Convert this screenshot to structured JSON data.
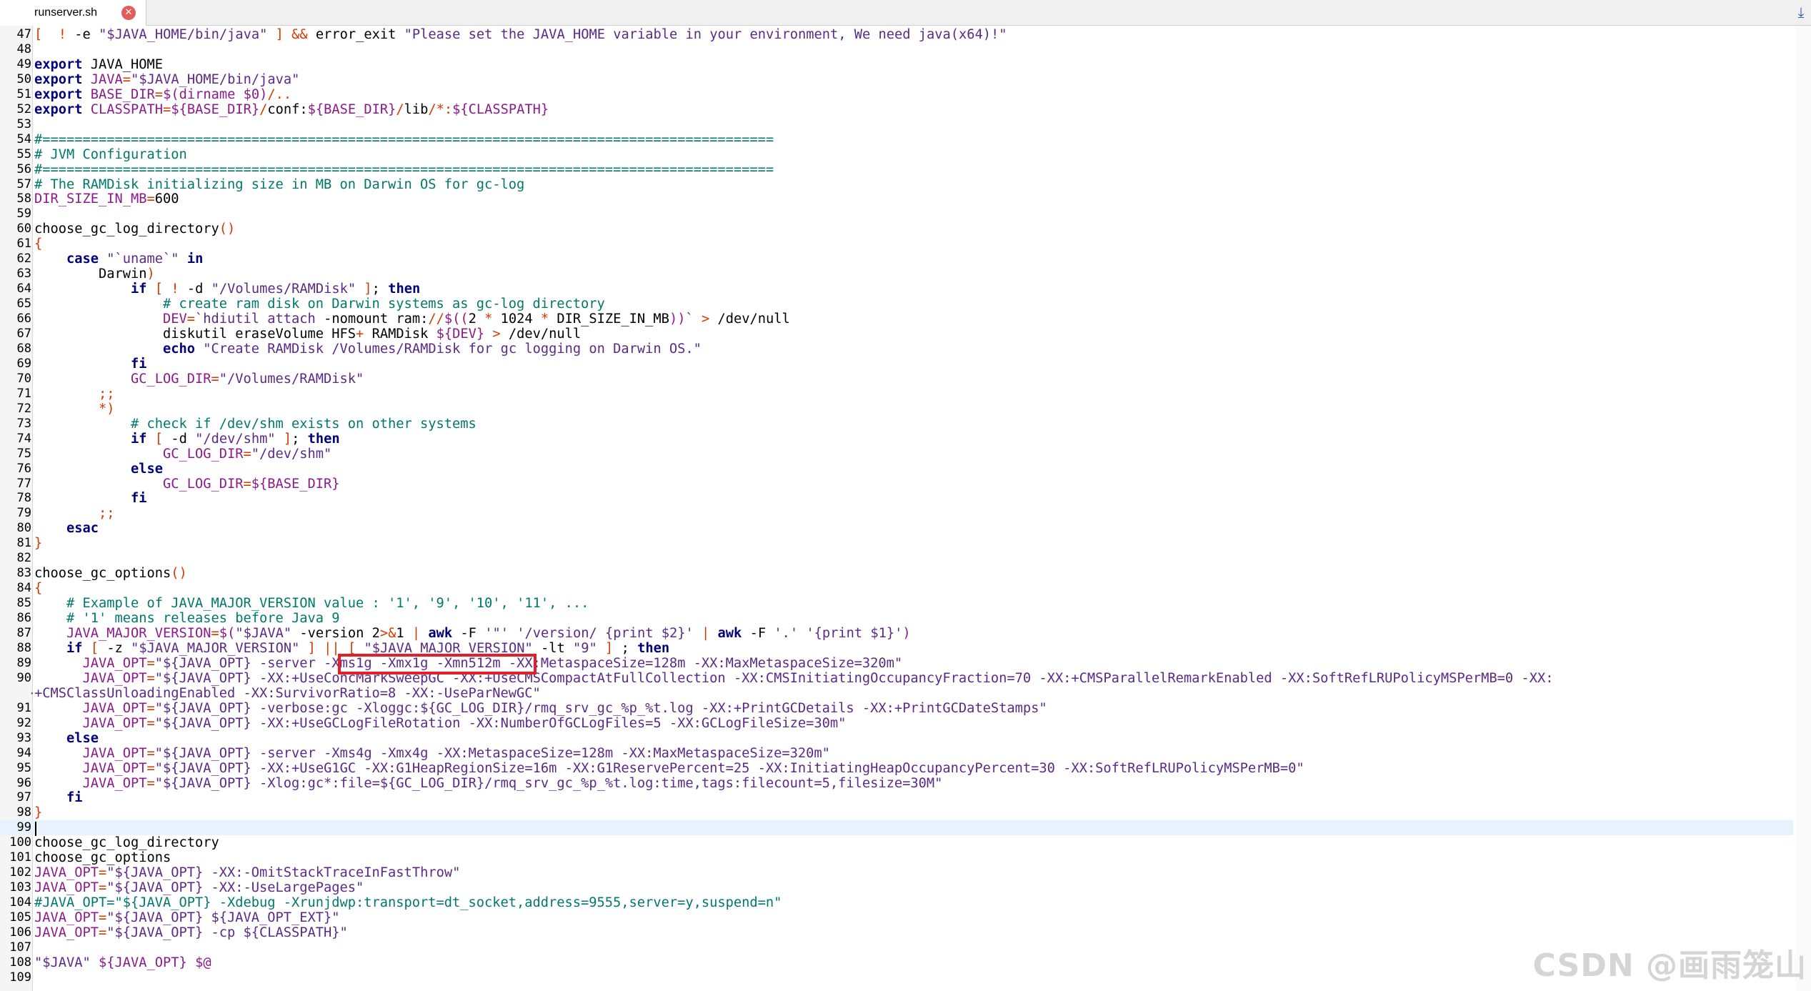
{
  "tab": {
    "title": "runserver.sh",
    "close_icon": "close-icon",
    "scroll_icon": "down-arrow-icon"
  },
  "watermark": "CSDN @画雨笼山",
  "colors": {
    "keyword": "#00007a",
    "string": "#5b2a86",
    "variable": "#8b1a8b",
    "comment": "#00796b",
    "operator": "#d63a00",
    "highlight_box": "#e3202a"
  },
  "current_line": 99,
  "lines": [
    {
      "n": "47",
      "t": [
        [
          "op",
          "["
        ],
        [
          "",
          "  "
        ],
        [
          "op",
          "!"
        ],
        [
          "",
          " -e "
        ],
        [
          "str",
          "\"$JAVA_HOME/bin/java\""
        ],
        [
          "",
          " "
        ],
        [
          "op",
          "]"
        ],
        [
          "",
          " "
        ],
        [
          "op",
          "&&"
        ],
        [
          "",
          " error_exit "
        ],
        [
          "str",
          "\"Please set the JAVA_HOME variable in your environment, We need java(x64)!\""
        ]
      ]
    },
    {
      "n": "48",
      "t": []
    },
    {
      "n": "49",
      "t": [
        [
          "kw",
          "export"
        ],
        [
          "",
          " JAVA_HOME"
        ]
      ]
    },
    {
      "n": "50",
      "t": [
        [
          "kw",
          "export"
        ],
        [
          "",
          " "
        ],
        [
          "var",
          "JAVA"
        ],
        [
          "op",
          "="
        ],
        [
          "str",
          "\"$JAVA_HOME/bin/java\""
        ]
      ]
    },
    {
      "n": "51",
      "t": [
        [
          "kw",
          "export"
        ],
        [
          "",
          " "
        ],
        [
          "var",
          "BASE_DIR"
        ],
        [
          "op",
          "="
        ],
        [
          "var",
          "$(dirname $0)"
        ],
        [
          "op",
          "/.."
        ]
      ]
    },
    {
      "n": "52",
      "t": [
        [
          "kw",
          "export"
        ],
        [
          "",
          " "
        ],
        [
          "var",
          "CLASSPATH"
        ],
        [
          "op",
          "="
        ],
        [
          ".:"
        ],
        [
          "var",
          "${BASE_DIR}"
        ],
        [
          "op",
          "/"
        ],
        [
          "",
          "conf:"
        ],
        [
          "var",
          "${BASE_DIR}"
        ],
        [
          "op",
          "/"
        ],
        [
          "",
          "lib"
        ],
        [
          "op",
          "/*:"
        ],
        [
          "var",
          "${CLASSPATH}"
        ]
      ]
    },
    {
      "n": "53",
      "t": []
    },
    {
      "n": "54",
      "t": [
        [
          "com",
          "#==========================================================================================="
        ]
      ]
    },
    {
      "n": "55",
      "t": [
        [
          "com",
          "# JVM Configuration"
        ]
      ]
    },
    {
      "n": "56",
      "t": [
        [
          "com",
          "#==========================================================================================="
        ]
      ]
    },
    {
      "n": "57",
      "t": [
        [
          "com",
          "# The RAMDisk initializing size in MB on Darwin OS for gc-log"
        ]
      ]
    },
    {
      "n": "58",
      "t": [
        [
          "var",
          "DIR_SIZE_IN_MB"
        ],
        [
          "op",
          "="
        ],
        [
          "",
          "600"
        ]
      ]
    },
    {
      "n": "59",
      "t": []
    },
    {
      "n": "60",
      "t": [
        [
          "",
          "choose_gc_log_directory"
        ],
        [
          "op",
          "()"
        ]
      ]
    },
    {
      "n": "61",
      "t": [
        [
          "op",
          "{"
        ]
      ]
    },
    {
      "n": "62",
      "t": [
        [
          "",
          "    "
        ],
        [
          "kw",
          "case"
        ],
        [
          "",
          " "
        ],
        [
          "str",
          "\"`uname`\""
        ],
        [
          "",
          " "
        ],
        [
          "kw",
          "in"
        ]
      ]
    },
    {
      "n": "63",
      "t": [
        [
          "",
          "        Darwin"
        ],
        [
          "op",
          ")"
        ]
      ]
    },
    {
      "n": "64",
      "t": [
        [
          "",
          "            "
        ],
        [
          "kw",
          "if"
        ],
        [
          "",
          " "
        ],
        [
          "op",
          "["
        ],
        [
          "",
          " "
        ],
        [
          "op",
          "!"
        ],
        [
          "",
          " -d "
        ],
        [
          "str",
          "\"/Volumes/RAMDisk\""
        ],
        [
          "",
          " "
        ],
        [
          "op",
          "]"
        ],
        [
          "",
          ";"
        ],
        [
          "",
          " "
        ],
        [
          "kw",
          "then"
        ]
      ]
    },
    {
      "n": "65",
      "t": [
        [
          "",
          "                "
        ],
        [
          "com",
          "# create ram disk on Darwin systems as gc-log directory"
        ]
      ]
    },
    {
      "n": "66",
      "t": [
        [
          "",
          "                "
        ],
        [
          "var",
          "DEV"
        ],
        [
          "op",
          "="
        ],
        [
          "str",
          "`hdiutil attach "
        ],
        [
          "",
          "-nomount ram:"
        ],
        [
          "op",
          "//"
        ],
        [
          "var",
          "$(("
        ],
        [
          "",
          "2 "
        ],
        [
          "op",
          "*"
        ],
        [
          "",
          " 1024 "
        ],
        [
          "op",
          "*"
        ],
        [
          "",
          " DIR_SIZE_IN_MB"
        ],
        [
          "var",
          "))"
        ],
        [
          "str",
          "`"
        ],
        [
          "",
          " "
        ],
        [
          "op",
          ">"
        ],
        [
          "",
          " /dev/null"
        ]
      ]
    },
    {
      "n": "67",
      "t": [
        [
          "",
          "                diskutil eraseVolume HFS"
        ],
        [
          "op",
          "+"
        ],
        [
          "",
          " RAMDisk "
        ],
        [
          "var",
          "${DEV}"
        ],
        [
          "",
          " "
        ],
        [
          "op",
          ">"
        ],
        [
          "",
          " /dev/null"
        ]
      ]
    },
    {
      "n": "68",
      "t": [
        [
          "",
          "                "
        ],
        [
          "kw",
          "echo"
        ],
        [
          "",
          " "
        ],
        [
          "str",
          "\"Create RAMDisk /Volumes/RAMDisk for gc logging on Darwin OS.\""
        ]
      ]
    },
    {
      "n": "69",
      "t": [
        [
          "",
          "            "
        ],
        [
          "kw",
          "fi"
        ]
      ]
    },
    {
      "n": "70",
      "t": [
        [
          "",
          "            "
        ],
        [
          "var",
          "GC_LOG_DIR"
        ],
        [
          "op",
          "="
        ],
        [
          "str",
          "\"/Volumes/RAMDisk\""
        ]
      ]
    },
    {
      "n": "71",
      "t": [
        [
          "",
          "        "
        ],
        [
          "op",
          ";;"
        ]
      ]
    },
    {
      "n": "72",
      "t": [
        [
          "",
          "        "
        ],
        [
          "op",
          "*)"
        ]
      ]
    },
    {
      "n": "73",
      "t": [
        [
          "",
          "            "
        ],
        [
          "com",
          "# check if /dev/shm exists on other systems"
        ]
      ]
    },
    {
      "n": "74",
      "t": [
        [
          "",
          "            "
        ],
        [
          "kw",
          "if"
        ],
        [
          "",
          " "
        ],
        [
          "op",
          "["
        ],
        [
          "",
          " -d "
        ],
        [
          "str",
          "\"/dev/shm\""
        ],
        [
          "",
          " "
        ],
        [
          "op",
          "]"
        ],
        [
          "",
          ";"
        ],
        [
          "",
          " "
        ],
        [
          "kw",
          "then"
        ]
      ]
    },
    {
      "n": "75",
      "t": [
        [
          "",
          "                "
        ],
        [
          "var",
          "GC_LOG_DIR"
        ],
        [
          "op",
          "="
        ],
        [
          "str",
          "\"/dev/shm\""
        ]
      ]
    },
    {
      "n": "76",
      "t": [
        [
          "",
          "            "
        ],
        [
          "kw",
          "else"
        ]
      ]
    },
    {
      "n": "77",
      "t": [
        [
          "",
          "                "
        ],
        [
          "var",
          "GC_LOG_DIR"
        ],
        [
          "op",
          "="
        ],
        [
          "var",
          "${BASE_DIR}"
        ]
      ]
    },
    {
      "n": "78",
      "t": [
        [
          "",
          "            "
        ],
        [
          "kw",
          "fi"
        ]
      ]
    },
    {
      "n": "79",
      "t": [
        [
          "",
          "        "
        ],
        [
          "op",
          ";;"
        ]
      ]
    },
    {
      "n": "80",
      "t": [
        [
          "",
          "    "
        ],
        [
          "kw",
          "esac"
        ]
      ]
    },
    {
      "n": "81",
      "t": [
        [
          "op",
          "}"
        ]
      ]
    },
    {
      "n": "82",
      "t": []
    },
    {
      "n": "83",
      "t": [
        [
          "",
          "choose_gc_options"
        ],
        [
          "op",
          "()"
        ]
      ]
    },
    {
      "n": "84",
      "t": [
        [
          "op",
          "{"
        ]
      ]
    },
    {
      "n": "85",
      "t": [
        [
          "",
          "    "
        ],
        [
          "com",
          "# Example of JAVA_MAJOR_VERSION value : '1', '9', '10', '11', ..."
        ]
      ]
    },
    {
      "n": "86",
      "t": [
        [
          "",
          "    "
        ],
        [
          "com",
          "# '1' means releases before Java 9"
        ]
      ]
    },
    {
      "n": "87",
      "t": [
        [
          "",
          "    "
        ],
        [
          "var",
          "JAVA_MAJOR_VERSION"
        ],
        [
          "op",
          "="
        ],
        [
          "var",
          "$("
        ],
        [
          "str",
          "\"$JAVA\""
        ],
        [
          "",
          " -version 2"
        ],
        [
          "op",
          ">&"
        ],
        [
          "",
          "1 "
        ],
        [
          "op",
          "|"
        ],
        [
          "",
          " "
        ],
        [
          "kw",
          "awk"
        ],
        [
          "",
          " -F "
        ],
        [
          "str",
          "'\"'"
        ],
        [
          "",
          " "
        ],
        [
          "str",
          "'/version/ {print $2}'"
        ],
        [
          "",
          " "
        ],
        [
          "op",
          "|"
        ],
        [
          "",
          " "
        ],
        [
          "kw",
          "awk"
        ],
        [
          "",
          " -F "
        ],
        [
          "str",
          "'.'"
        ],
        [
          "",
          " "
        ],
        [
          "str",
          "'{print $1}'"
        ],
        [
          "var",
          ")"
        ]
      ]
    },
    {
      "n": "88",
      "t": [
        [
          "",
          "    "
        ],
        [
          "kw",
          "if"
        ],
        [
          "",
          " "
        ],
        [
          "op",
          "["
        ],
        [
          "",
          " -z "
        ],
        [
          "str",
          "\"$JAVA_MAJOR_VERSION\""
        ],
        [
          "",
          " "
        ],
        [
          "op",
          "]"
        ],
        [
          "",
          " "
        ],
        [
          "op",
          "||"
        ],
        [
          "",
          " "
        ],
        [
          "op",
          "["
        ],
        [
          "",
          " "
        ],
        [
          "str",
          "\"$JAVA_MAJOR_VERSION\""
        ],
        [
          "",
          " -lt "
        ],
        [
          "str",
          "\"9\""
        ],
        [
          "",
          " "
        ],
        [
          "op",
          "]"
        ],
        [
          "",
          " ; "
        ],
        [
          "kw",
          "then"
        ]
      ]
    },
    {
      "n": "89",
      "t": [
        [
          "",
          "      "
        ],
        [
          "var",
          "JAVA_OPT"
        ],
        [
          "op",
          "="
        ],
        [
          "str",
          "\"${JAVA_OPT} -server -Xms1g -Xmx1g -Xmn512m -XX:MetaspaceSize=128m -XX:MaxMetaspaceSize=320m\""
        ]
      ]
    },
    {
      "n": "90",
      "t": [
        [
          "",
          "      "
        ],
        [
          "var",
          "JAVA_OPT"
        ],
        [
          "op",
          "="
        ],
        [
          "str",
          "\"${JAVA_OPT} -XX:+UseConcMarkSweepGC -XX:+UseCMSCompactAtFullCollection -XX:CMSInitiatingOccupancyFraction=70 -XX:+CMSParallelRemarkEnabled -XX:SoftRefLRUPolicyMSPerMB=0 -XX:"
        ]
      ]
    },
    {
      "n": "",
      "t": [
        [
          "str",
          "+CMSClassUnloadingEnabled -XX:SurvivorRatio=8 -XX:-UseParNewGC\""
        ]
      ],
      "wrap": true
    },
    {
      "n": "91",
      "t": [
        [
          "",
          "      "
        ],
        [
          "var",
          "JAVA_OPT"
        ],
        [
          "op",
          "="
        ],
        [
          "str",
          "\"${JAVA_OPT} -verbose:gc -Xloggc:${GC_LOG_DIR}/rmq_srv_gc_%p_%t.log -XX:+PrintGCDetails -XX:+PrintGCDateStamps\""
        ]
      ]
    },
    {
      "n": "92",
      "t": [
        [
          "",
          "      "
        ],
        [
          "var",
          "JAVA_OPT"
        ],
        [
          "op",
          "="
        ],
        [
          "str",
          "\"${JAVA_OPT} -XX:+UseGCLogFileRotation -XX:NumberOfGCLogFiles=5 -XX:GCLogFileSize=30m\""
        ]
      ]
    },
    {
      "n": "93",
      "t": [
        [
          "",
          "    "
        ],
        [
          "kw",
          "else"
        ]
      ]
    },
    {
      "n": "94",
      "t": [
        [
          "",
          "      "
        ],
        [
          "var",
          "JAVA_OPT"
        ],
        [
          "op",
          "="
        ],
        [
          "str",
          "\"${JAVA_OPT} -server -Xms4g -Xmx4g -XX:MetaspaceSize=128m -XX:MaxMetaspaceSize=320m\""
        ]
      ]
    },
    {
      "n": "95",
      "t": [
        [
          "",
          "      "
        ],
        [
          "var",
          "JAVA_OPT"
        ],
        [
          "op",
          "="
        ],
        [
          "str",
          "\"${JAVA_OPT} -XX:+UseG1GC -XX:G1HeapRegionSize=16m -XX:G1ReservePercent=25 -XX:InitiatingHeapOccupancyPercent=30 -XX:SoftRefLRUPolicyMSPerMB=0\""
        ]
      ]
    },
    {
      "n": "96",
      "t": [
        [
          "",
          "      "
        ],
        [
          "var",
          "JAVA_OPT"
        ],
        [
          "op",
          "="
        ],
        [
          "str",
          "\"${JAVA_OPT} -Xlog:gc*:file=${GC_LOG_DIR}/rmq_srv_gc_%p_%t.log:time,tags:filecount=5,filesize=30M\""
        ]
      ]
    },
    {
      "n": "97",
      "t": [
        [
          "",
          "    "
        ],
        [
          "kw",
          "fi"
        ]
      ]
    },
    {
      "n": "98",
      "t": [
        [
          "op",
          "}"
        ]
      ]
    },
    {
      "n": "99",
      "t": [],
      "current": true
    },
    {
      "n": "100",
      "t": [
        [
          "",
          "choose_gc_log_directory"
        ]
      ]
    },
    {
      "n": "101",
      "t": [
        [
          "",
          "choose_gc_options"
        ]
      ]
    },
    {
      "n": "102",
      "t": [
        [
          "var",
          "JAVA_OPT"
        ],
        [
          "op",
          "="
        ],
        [
          "str",
          "\"${JAVA_OPT} -XX:-OmitStackTraceInFastThrow\""
        ]
      ]
    },
    {
      "n": "103",
      "t": [
        [
          "var",
          "JAVA_OPT"
        ],
        [
          "op",
          "="
        ],
        [
          "str",
          "\"${JAVA_OPT} -XX:-UseLargePages\""
        ]
      ]
    },
    {
      "n": "104",
      "t": [
        [
          "com",
          "#JAVA_OPT=\"${JAVA_OPT} -Xdebug -Xrunjdwp:transport=dt_socket,address=9555,server=y,suspend=n\""
        ]
      ]
    },
    {
      "n": "105",
      "t": [
        [
          "var",
          "JAVA_OPT"
        ],
        [
          "op",
          "="
        ],
        [
          "str",
          "\"${JAVA_OPT} ${JAVA_OPT_EXT}\""
        ]
      ]
    },
    {
      "n": "106",
      "t": [
        [
          "var",
          "JAVA_OPT"
        ],
        [
          "op",
          "="
        ],
        [
          "str",
          "\"${JAVA_OPT} -cp ${CLASSPATH}\""
        ]
      ]
    },
    {
      "n": "107",
      "t": []
    },
    {
      "n": "108",
      "t": [
        [
          "str",
          "\"$JAVA\""
        ],
        [
          "",
          " "
        ],
        [
          "var",
          "${JAVA_OPT}"
        ],
        [
          "",
          " "
        ],
        [
          "var",
          "$@"
        ]
      ]
    },
    {
      "n": "109",
      "t": []
    }
  ]
}
